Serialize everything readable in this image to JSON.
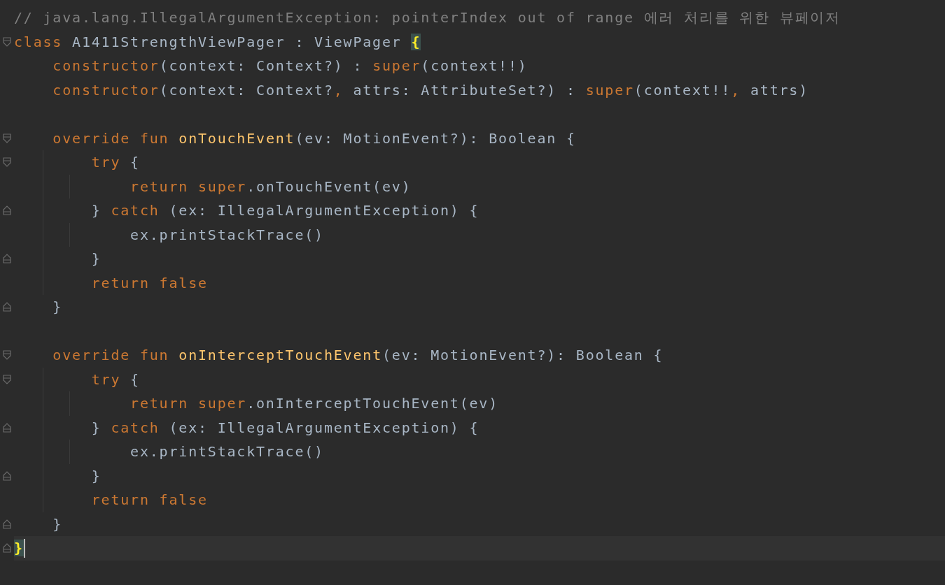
{
  "lines": [
    {
      "kind": "plain",
      "caret": false,
      "tokens": [
        {
          "kind": "comment",
          "text": "// java.lang.IllegalArgumentException: pointerIndex out of range 에러 처리를 위한 뷰페이저"
        }
      ]
    },
    {
      "kind": "fold_start",
      "caret": false,
      "tokens": [
        {
          "kind": "keyword",
          "text": "class "
        },
        {
          "kind": "plain",
          "text": "A1411StrengthViewPager : ViewPager "
        },
        {
          "kind": "match",
          "text": "{"
        }
      ]
    },
    {
      "kind": "plain",
      "caret": false,
      "tokens": [
        {
          "kind": "keyword",
          "text": "    constructor"
        },
        {
          "kind": "plain",
          "text": "(context: Context?) : "
        },
        {
          "kind": "keyword",
          "text": "super"
        },
        {
          "kind": "plain",
          "text": "(context!!)"
        }
      ]
    },
    {
      "kind": "plain",
      "caret": false,
      "tokens": [
        {
          "kind": "keyword",
          "text": "    constructor"
        },
        {
          "kind": "plain",
          "text": "(context: Context?"
        },
        {
          "kind": "keyword",
          "text": ", "
        },
        {
          "kind": "plain",
          "text": "attrs: AttributeSet?) : "
        },
        {
          "kind": "keyword",
          "text": "super"
        },
        {
          "kind": "plain",
          "text": "(context!!"
        },
        {
          "kind": "keyword",
          "text": ", "
        },
        {
          "kind": "plain",
          "text": "attrs)"
        }
      ]
    },
    {
      "kind": "plain",
      "caret": false
    },
    {
      "kind": "fold_start",
      "caret": false,
      "tokens": [
        {
          "kind": "keyword",
          "text": "    override fun "
        },
        {
          "kind": "func",
          "text": "onTouchEvent"
        },
        {
          "kind": "plain",
          "text": "(ev: MotionEvent?): Boolean {"
        }
      ]
    },
    {
      "kind": "fold_start",
      "caret": false,
      "tokens": [
        {
          "kind": "keyword",
          "text": "        try "
        },
        {
          "kind": "plain",
          "text": "{"
        }
      ]
    },
    {
      "kind": "plain",
      "caret": false,
      "tokens": [
        {
          "kind": "keyword",
          "text": "            return super"
        },
        {
          "kind": "plain",
          "text": ".onTouchEvent(ev)"
        }
      ]
    },
    {
      "kind": "fold_end",
      "caret": false,
      "tokens": [
        {
          "kind": "plain",
          "text": "        } "
        },
        {
          "kind": "keyword",
          "text": "catch "
        },
        {
          "kind": "plain",
          "text": "(ex: IllegalArgumentException) {"
        }
      ]
    },
    {
      "kind": "plain",
      "caret": false,
      "tokens": [
        {
          "kind": "plain",
          "text": "            ex.printStackTrace()"
        }
      ]
    },
    {
      "kind": "fold_end",
      "caret": false,
      "tokens": [
        {
          "kind": "plain",
          "text": "        }"
        }
      ]
    },
    {
      "kind": "plain",
      "caret": false,
      "tokens": [
        {
          "kind": "keyword",
          "text": "        return false"
        }
      ]
    },
    {
      "kind": "fold_end",
      "caret": false,
      "tokens": [
        {
          "kind": "plain",
          "text": "    }"
        }
      ]
    },
    {
      "kind": "plain",
      "caret": false
    },
    {
      "kind": "fold_start",
      "caret": false,
      "tokens": [
        {
          "kind": "keyword",
          "text": "    override fun "
        },
        {
          "kind": "func",
          "text": "onInterceptTouchEvent"
        },
        {
          "kind": "plain",
          "text": "(ev: MotionEvent?): Boolean {"
        }
      ]
    },
    {
      "kind": "fold_start",
      "caret": false,
      "tokens": [
        {
          "kind": "keyword",
          "text": "        try "
        },
        {
          "kind": "plain",
          "text": "{"
        }
      ]
    },
    {
      "kind": "plain",
      "caret": false,
      "tokens": [
        {
          "kind": "keyword",
          "text": "            return super"
        },
        {
          "kind": "plain",
          "text": ".onInterceptTouchEvent(ev)"
        }
      ]
    },
    {
      "kind": "fold_end",
      "caret": false,
      "tokens": [
        {
          "kind": "plain",
          "text": "        } "
        },
        {
          "kind": "keyword",
          "text": "catch "
        },
        {
          "kind": "plain",
          "text": "(ex: IllegalArgumentException) {"
        }
      ]
    },
    {
      "kind": "plain",
      "caret": false,
      "tokens": [
        {
          "kind": "plain",
          "text": "            ex.printStackTrace()"
        }
      ]
    },
    {
      "kind": "fold_end",
      "caret": false,
      "tokens": [
        {
          "kind": "plain",
          "text": "        }"
        }
      ]
    },
    {
      "kind": "plain",
      "caret": false,
      "tokens": [
        {
          "kind": "keyword",
          "text": "        return false"
        }
      ]
    },
    {
      "kind": "fold_end",
      "caret": false,
      "tokens": [
        {
          "kind": "plain",
          "text": "    }"
        }
      ]
    },
    {
      "kind": "fold_end",
      "caret": true,
      "tokens": [
        {
          "kind": "match",
          "text": "}"
        }
      ]
    }
  ]
}
